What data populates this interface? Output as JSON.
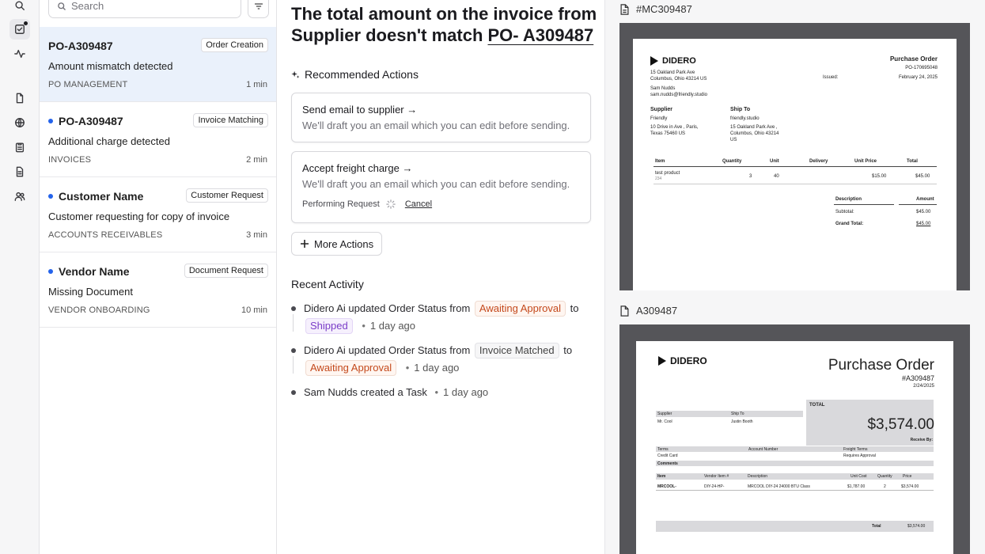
{
  "search": {
    "placeholder": "Search"
  },
  "tasks": [
    {
      "id": "PO-A309487",
      "tag": "Order Creation",
      "subtitle": "Amount mismatch detected",
      "category": "PO MANAGEMENT",
      "time": "1 min"
    },
    {
      "id": "PO-A309487",
      "tag": "Invoice Matching",
      "subtitle": "Additional charge detected",
      "category": "INVOICES",
      "time": "2 min"
    },
    {
      "id": "Customer Name",
      "tag": "Customer Request",
      "subtitle": "Customer requesting for copy of invoice",
      "category": "ACCOUNTS RECEIVABLES",
      "time": "3 min"
    },
    {
      "id": "Vendor Name",
      "tag": "Document Request",
      "subtitle": "Missing Document",
      "category": "VENDOR ONBOARDING",
      "time": "10 min"
    }
  ],
  "detail": {
    "title_prefix": "The total amount on the invoice from Supplier doesn't match ",
    "title_link": "PO- A309487",
    "recommended_heading": "Recommended Actions",
    "actions": [
      {
        "title": "Send email to supplier →",
        "desc": "We'll draft you an email which you can edit before sending."
      },
      {
        "title": "Accept freight charge →",
        "desc": "We'll draft you an email which you can edit before sending.",
        "status": "Performing Request",
        "cancel": "Cancel"
      }
    ],
    "more_actions": "More Actions",
    "activity_heading": "Recent Activity",
    "activity": [
      {
        "actor": "Didero Ai",
        "verb": "updated Order Status from",
        "from": "Awaiting Approval",
        "to_word": "to",
        "to": "Shipped",
        "ago": "1 day ago"
      },
      {
        "actor": "Didero Ai",
        "verb": "updated Order Status from",
        "from": "Invoice Matched",
        "to_word": "to",
        "to": "Awaiting Approval",
        "ago": "1 day ago"
      },
      {
        "actor": "Sam Nudds",
        "verb": "created a Task",
        "ago": "1 day ago"
      }
    ]
  },
  "documents": [
    {
      "label": "#MC309487",
      "brand": "DIDERO",
      "doc_title": "Purchase Order",
      "po_number": "PO-170695048",
      "issued_label": "Issued:",
      "issued_date": "February 24, 2025",
      "from_lines": [
        "15 Oakland Park Ave",
        "Columbus, Ohio 43214 US",
        "",
        "Sam Nudds",
        "sam.nudds@friendly.studio"
      ],
      "supplier_label": "Supplier",
      "supplier_lines": [
        "Friendly",
        "",
        "10 Drive in Ave , Paris,",
        "Texas 75460 US"
      ],
      "shipto_label": "Ship To",
      "shipto_lines": [
        "friendly.studio",
        "",
        "15 Oakland Park Ave ,",
        "Columbus, Ohio 43214",
        "US"
      ],
      "table_headers": [
        "Item",
        "Quantity",
        "Unit",
        "Delivery",
        "Unit Price",
        "Total"
      ],
      "row": {
        "item": "test product",
        "sub": "234",
        "qty": "3",
        "unit": "40",
        "delivery": "",
        "price": "$15.00",
        "total": "$45.00"
      },
      "summary_headers": [
        "Description",
        "Amount"
      ],
      "subtotal_label": "Subtotal:",
      "subtotal": "$45.00",
      "grand_label": "Grand Total:",
      "grand": "$45.00"
    },
    {
      "label": "A309487",
      "brand": "DIDERO",
      "doc_title": "Purchase Order",
      "po_number": "#A309487",
      "date": "2/24/2025",
      "total_label": "TOTAL",
      "total": "$3,574.00",
      "receive_by": "Receive By:",
      "supplier_label": "Supplier",
      "supplier": "Mr. Cool",
      "shipto_label": "Ship To",
      "shipto": "Justin Booth",
      "terms_label": "Terms",
      "terms": "Credit Card",
      "account_label": "Account Number",
      "freight_label": "Freight Terms",
      "freight": "Requires Approval",
      "comments_label": "Comments",
      "table_headers": [
        "Item",
        "Vendor Item #",
        "Description",
        "Unit Cost",
        "Quantity",
        "Price"
      ],
      "row": {
        "item": "MRCOOL-",
        "vendor": "DIY-24-HP-",
        "desc": "MRCOOL DIY-24 24000 BTU Class",
        "cost": "$1,787.00",
        "qty": "2",
        "price": "$3,574.00"
      },
      "footer_label": "Total",
      "footer_total": "$3,574.00"
    }
  ],
  "colors": {
    "selected_card": "#eaf1fb",
    "unread_dot": "#2463eb",
    "status_orange": "#c4491c",
    "status_purple": "#7a3cc8"
  }
}
